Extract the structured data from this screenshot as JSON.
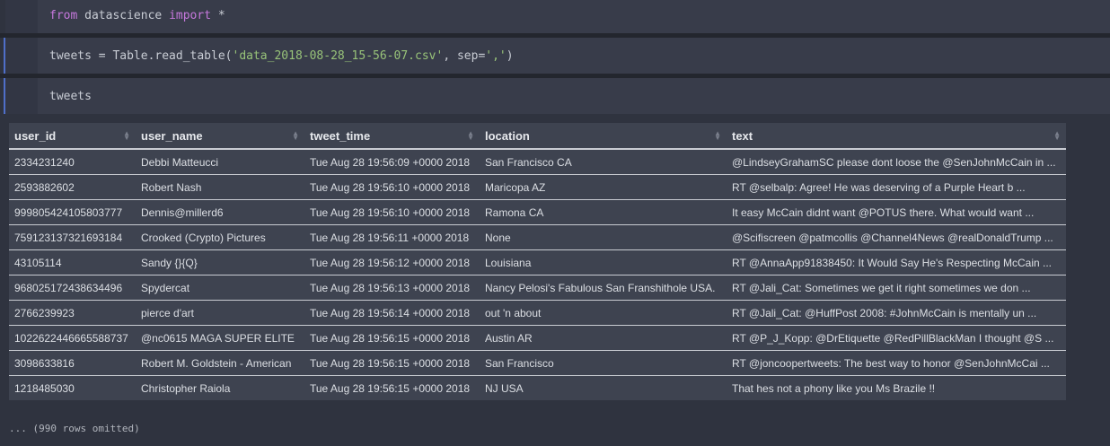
{
  "cells": [
    {
      "tokens": [
        {
          "t": "from",
          "c": "kw"
        },
        {
          "t": " datascience ",
          "c": "op"
        },
        {
          "t": "import",
          "c": "kw"
        },
        {
          "t": " *",
          "c": "op"
        }
      ]
    },
    {
      "tokens": [
        {
          "t": "tweets = Table.read_table(",
          "c": "op"
        },
        {
          "t": "'data_2018-08-28_15-56-07.csv'",
          "c": "str"
        },
        {
          "t": ", sep=",
          "c": "op"
        },
        {
          "t": "','",
          "c": "str"
        },
        {
          "t": ")",
          "c": "op"
        }
      ]
    },
    {
      "tokens": [
        {
          "t": "tweets",
          "c": "op"
        }
      ]
    }
  ],
  "table": {
    "columns": [
      "user_id",
      "user_name",
      "tweet_time",
      "location",
      "text"
    ],
    "rows": [
      [
        "2334231240",
        "Debbi Matteucci",
        "Tue Aug 28 19:56:09 +0000 2018",
        "San Francisco CA",
        "@LindseyGrahamSC please dont loose the @SenJohnMcCain in ..."
      ],
      [
        "2593882602",
        "Robert Nash",
        "Tue Aug 28 19:56:10 +0000 2018",
        "Maricopa AZ",
        "RT @selbalp: Agree! He was deserving of a Purple Heart b ..."
      ],
      [
        "999805424105803777",
        "Dennis@millerd6",
        "Tue Aug 28 19:56:10 +0000 2018",
        "Ramona CA",
        "It easy McCain didnt want @POTUS there. What would want ..."
      ],
      [
        "759123137321693184",
        "Crooked (Crypto) Pictures",
        "Tue Aug 28 19:56:11 +0000 2018",
        "None",
        "@Scifiscreen @patmcollis @Channel4News @realDonaldTrump ..."
      ],
      [
        "43105114",
        "Sandy {}{Q}",
        "Tue Aug 28 19:56:12 +0000 2018",
        "Louisiana",
        "RT @AnnaApp91838450: It Would Say He's Respecting McCain ..."
      ],
      [
        "968025172438634496",
        "Spydercat",
        "Tue Aug 28 19:56:13 +0000 2018",
        "Nancy Pelosi's Fabulous San Franshithole USA.",
        "RT @Jali_Cat: Sometimes we get it right sometimes we don ..."
      ],
      [
        "2766239923",
        "pierce d'art",
        "Tue Aug 28 19:56:14 +0000 2018",
        "out 'n about",
        "RT @Jali_Cat: @HuffPost 2008: #JohnMcCain is mentally un ..."
      ],
      [
        "1022622446665588737",
        "@nc0615 MAGA SUPER ELITE",
        "Tue Aug 28 19:56:15 +0000 2018",
        "Austin AR",
        "RT @P_J_Kopp: @DrEtiquette @RedPillBlackMan I thought @S ..."
      ],
      [
        "3098633816",
        "Robert M. Goldstein - American",
        "Tue Aug 28 19:56:15 +0000 2018",
        "San Francisco",
        "RT @joncoopertweets: The best way to honor @SenJohnMcCai ..."
      ],
      [
        "1218485030",
        "Christopher Raiola",
        "Tue Aug 28 19:56:15 +0000 2018",
        "NJ USA",
        "That hes not a phony like you Ms Brazile !!"
      ]
    ]
  },
  "omitted_text": "... (990 rows omitted)"
}
